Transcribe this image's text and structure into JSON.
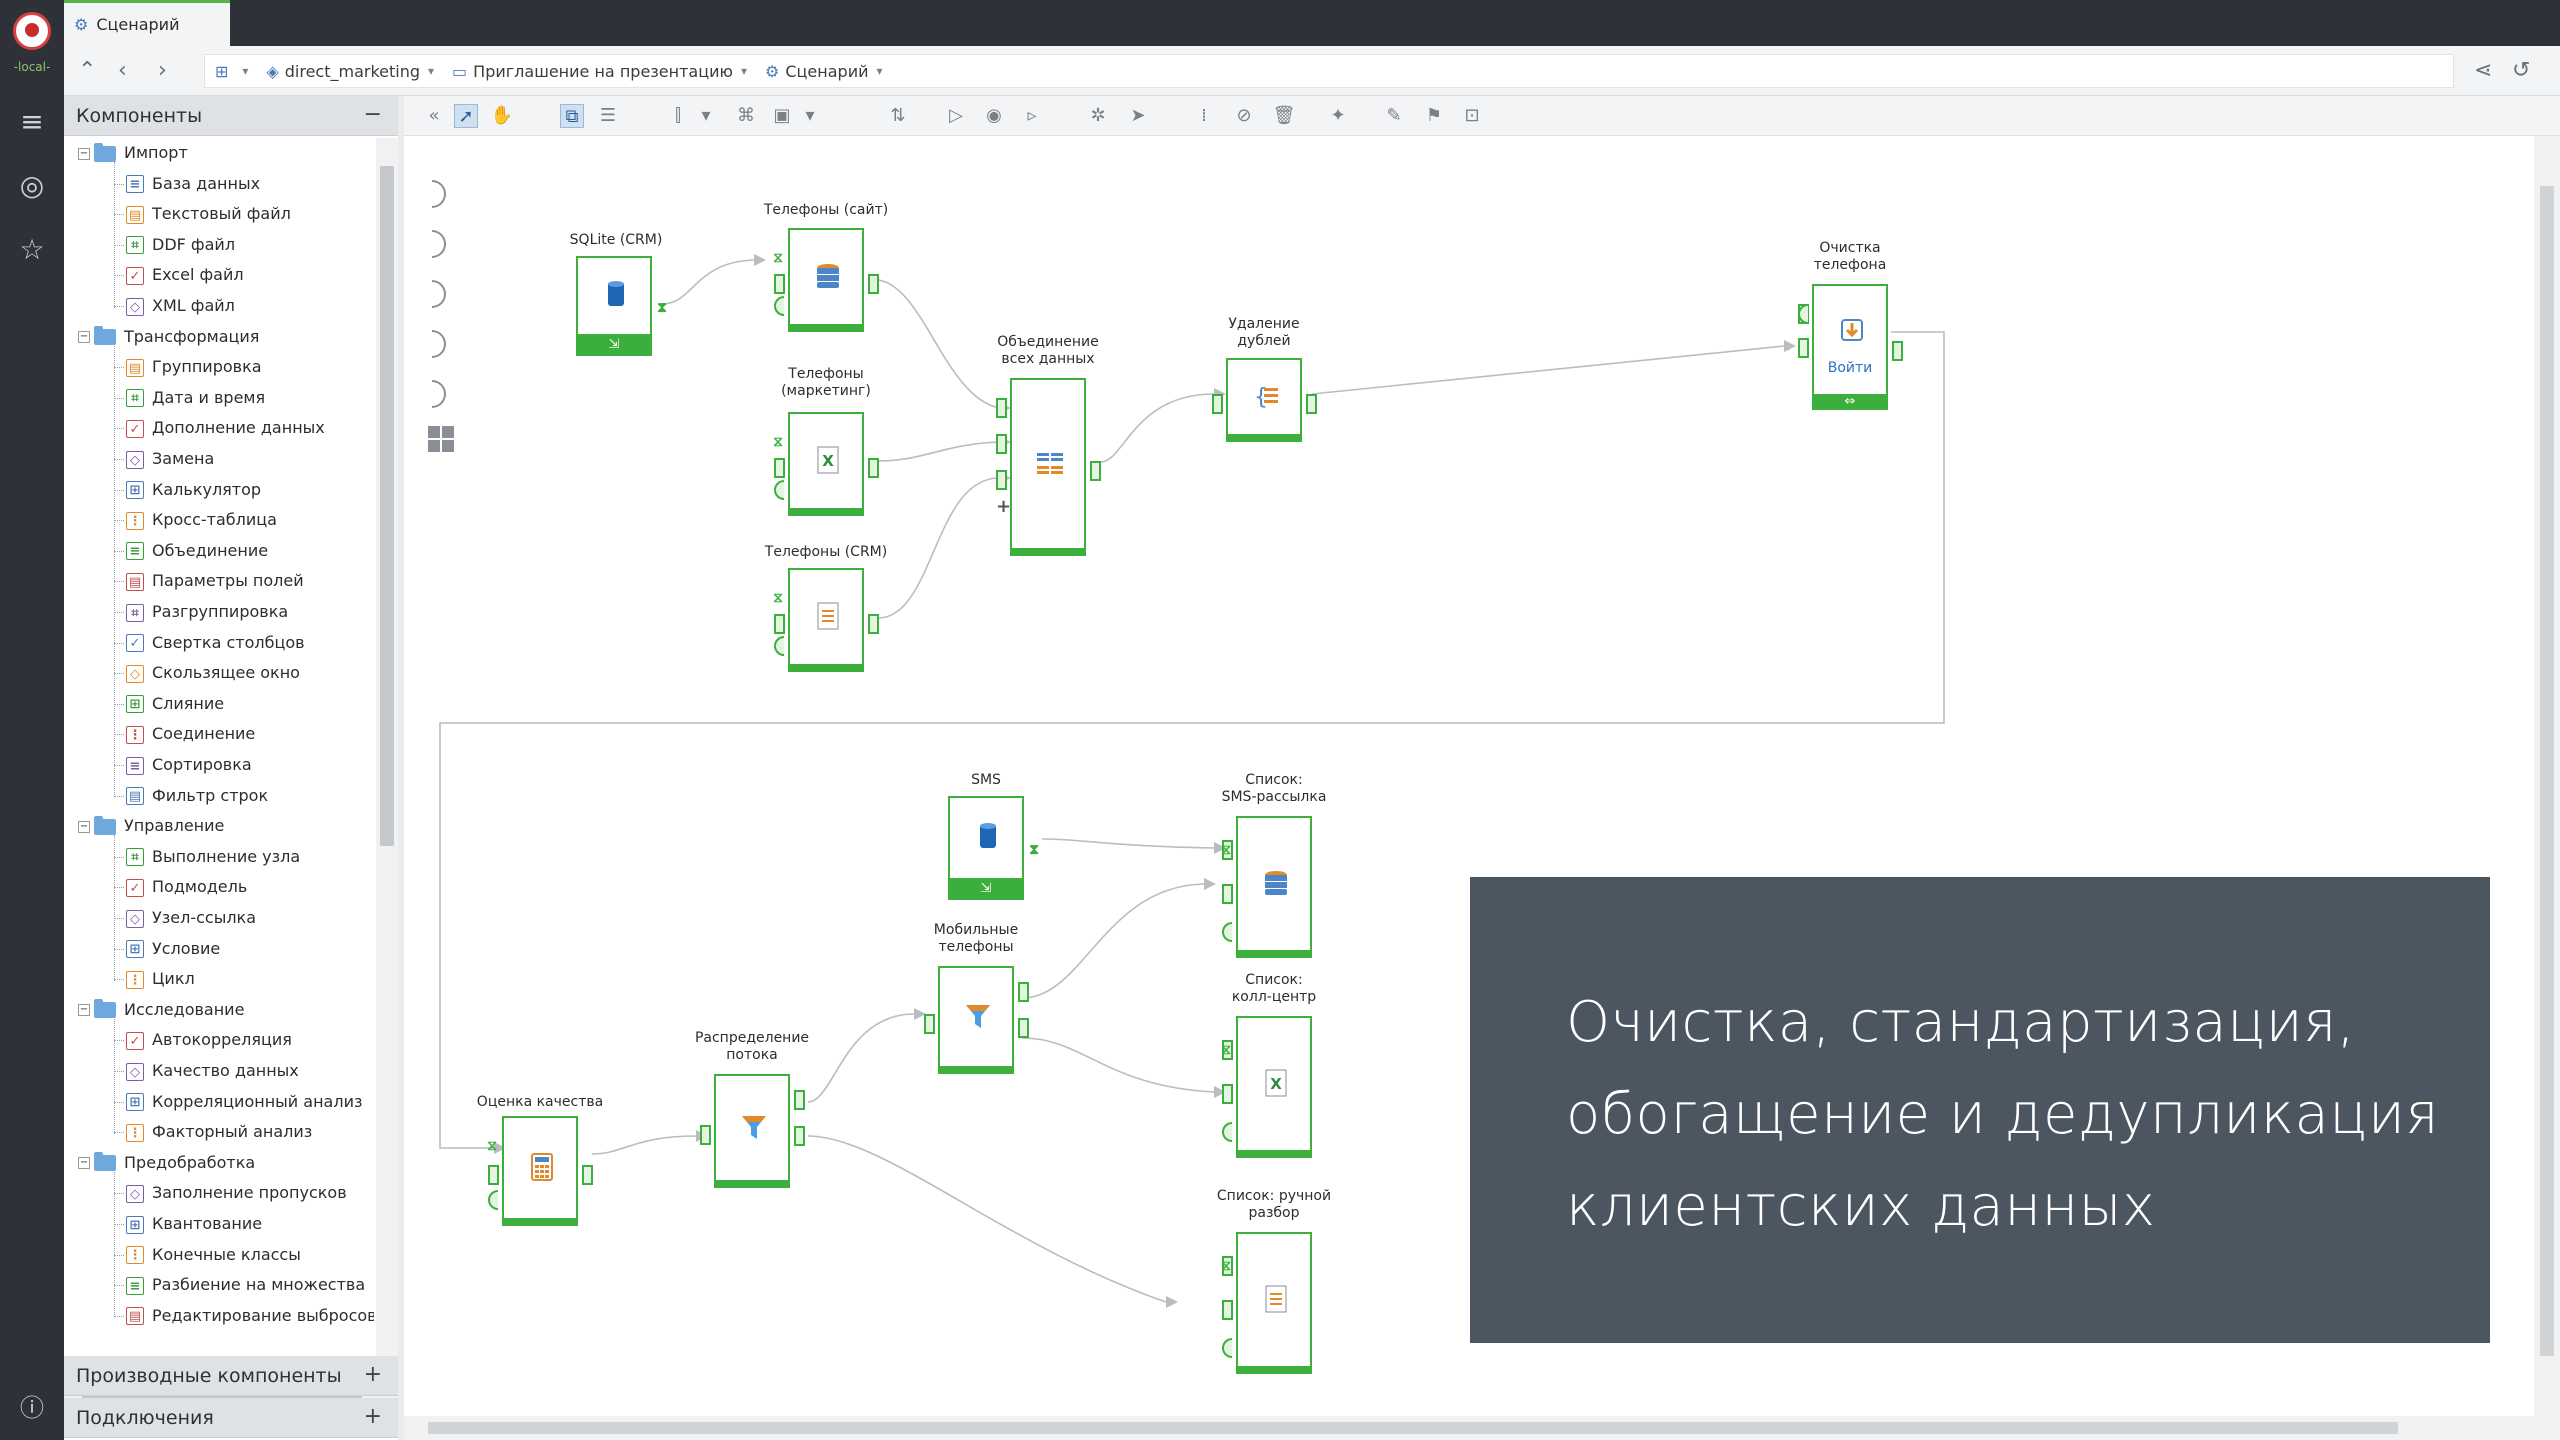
{
  "app": {
    "env_label": "-local-"
  },
  "tab": {
    "title": "Сценарий"
  },
  "breadcrumbs": [
    {
      "label": "direct_marketing"
    },
    {
      "label": "Приглашение на презентацию"
    },
    {
      "label": "Сценарий"
    }
  ],
  "panel": {
    "components_title": "Компоненты",
    "derived_title": "Производные компоненты",
    "connections_title": "Подключения",
    "tree": [
      {
        "label": "Импорт",
        "type": "folder",
        "children": [
          "База данных",
          "Текстовый файл",
          "DDF файл",
          "Excel файл",
          "XML файл"
        ]
      },
      {
        "label": "Трансформация",
        "type": "folder",
        "children": [
          "Группировка",
          "Дата и время",
          "Дополнение данных",
          "Замена",
          "Калькулятор",
          "Кросс-таблица",
          "Объединение",
          "Параметры полей",
          "Разгруппировка",
          "Свертка столбцов",
          "Скользящее окно",
          "Слияние",
          "Соединение",
          "Сортировка",
          "Фильтр строк"
        ]
      },
      {
        "label": "Управление",
        "type": "folder",
        "children": [
          "Выполнение узла",
          "Подмодель",
          "Узел-ссылка",
          "Условие",
          "Цикл"
        ]
      },
      {
        "label": "Исследование",
        "type": "folder",
        "children": [
          "Автокорреляция",
          "Качество данных",
          "Корреляционный анализ",
          "Факторный анализ"
        ]
      },
      {
        "label": "Предобработка",
        "type": "folder",
        "children": [
          "Заполнение пропусков",
          "Квантование",
          "Конечные классы",
          "Разбиение на множества",
          "Редактирование выбросов"
        ]
      }
    ]
  },
  "nodes": {
    "sqlite_crm": "SQLite (CRM)",
    "phones_site": "Телефоны (сайт)",
    "phones_marketing": "Телефоны\n(маркетинг)",
    "phones_crm": "Телефоны (CRM)",
    "merge_all": "Объединение\nвсех данных",
    "dedup": "Удаление\nдублей",
    "clean_phone": "Очистка\nтелефона",
    "clean_phone_btn": "Войти",
    "sms": "SMS",
    "list_sms": "Список:\nSMS-рассылка",
    "mobile_phones": "Мобильные\nтелефоны",
    "list_callcenter": "Список:\nколл-центр",
    "quality": "Оценка качества",
    "flow_split": "Распределение\nпотока",
    "list_manual": "Список: ручной\nразбор"
  },
  "overlay": {
    "lines": [
      "Очистка, стандартизация,",
      "обогащение и дедупликация",
      "клиентских данных"
    ]
  },
  "colors": {
    "accent": "#3cae3c",
    "overlay_bg": "#4b5660",
    "sidebar_bg": "#2e3238"
  }
}
